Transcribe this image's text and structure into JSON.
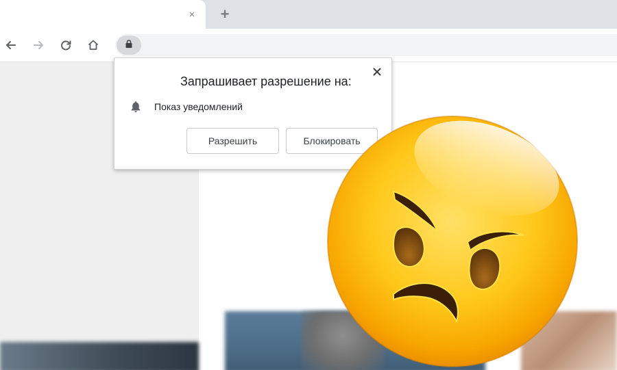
{
  "browser": {
    "tab_close_glyph": "×",
    "new_tab_glyph": "+",
    "toolbar_icons": [
      "back-arrow-icon",
      "forward-arrow-icon",
      "reload-icon",
      "home-icon",
      "lock-icon"
    ]
  },
  "permission_popup": {
    "title": "Запрашивает разрешение на:",
    "permission_label": "Показ уведомлений",
    "permission_icon": "bell-icon",
    "allow_button": "Разрешить",
    "block_button": "Блокировать",
    "close_icon": "close-icon"
  },
  "overlay": {
    "emoji": "angry-face-emoji",
    "face_color": "#f7b500"
  }
}
